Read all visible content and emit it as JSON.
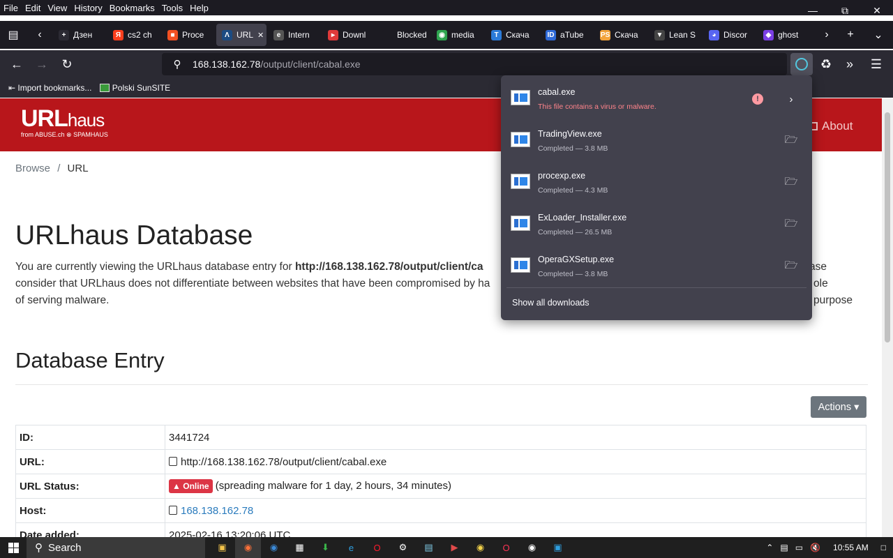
{
  "menu": [
    "File",
    "Edit",
    "View",
    "History",
    "Bookmarks",
    "Tools",
    "Help"
  ],
  "tabs": [
    {
      "label": "Дзен",
      "icon": "zen-icon",
      "color": "#2b2a33",
      "glyph": "+"
    },
    {
      "label": "cs2 ch",
      "icon": "yandex-icon",
      "color": "#fc3f1d",
      "glyph": "Я"
    },
    {
      "label": "Proce",
      "icon": "microsoft-icon",
      "color": "#f25022",
      "glyph": "■"
    },
    {
      "label": "URL",
      "icon": "abuse-icon",
      "color": "#1c4b82",
      "glyph": "Λ",
      "active": true
    },
    {
      "label": "Intern",
      "icon": "internet-icon",
      "color": "#555",
      "glyph": "e"
    },
    {
      "label": "Downl",
      "icon": "download-site-icon",
      "color": "#e03a3a",
      "glyph": "▸"
    },
    {
      "label": "Blocked",
      "icon": "blocked-icon",
      "color": "#1c1b22",
      "glyph": ""
    },
    {
      "label": "media",
      "icon": "media-icon",
      "color": "#2ea44f",
      "glyph": "◉"
    },
    {
      "label": "Скача",
      "icon": "telegram-t-icon",
      "color": "#2b7bd8",
      "glyph": "T"
    },
    {
      "label": "aTube",
      "icon": "atube-icon",
      "color": "#2f6ad8",
      "glyph": "ID"
    },
    {
      "label": "Скача",
      "icon": "ps-icon",
      "color": "#f2a33a",
      "glyph": "PS"
    },
    {
      "label": "Lean S",
      "icon": "lean-icon",
      "color": "#444",
      "glyph": "▼"
    },
    {
      "label": "Discor",
      "icon": "discord-icon",
      "color": "#5865f2",
      "glyph": "◕"
    },
    {
      "label": "ghost",
      "icon": "ghost-icon",
      "color": "#7b3fe4",
      "glyph": "◆"
    }
  ],
  "url": {
    "host": "168.138.162.78",
    "path": "/output/client/cabal.exe"
  },
  "bookmarks": [
    {
      "label": "Import bookmarks...",
      "icon": "import-icon"
    },
    {
      "label": "Polski SunSITE",
      "icon": "sunsite-icon"
    }
  ],
  "site": {
    "logo_main": "URL",
    "logo_sub": "haus",
    "logo_from": "from ABUSE.ch  ⊗ SPAMHAUS",
    "about": "About",
    "breadcrumb_browse": "Browse",
    "breadcrumb_sep": "/",
    "breadcrumb_current": "URL",
    "title": "URLhaus Database",
    "intro_pre": "You are currently viewing the URLhaus database entry for ",
    "intro_bold": "http://168.138.162.78/output/client/ca",
    "intro_line1_tail": "ase",
    "intro_line2": "consider that URLhaus does not differentiate between websites that have been compromised by ha",
    "intro_line2_tail": "ole purpose",
    "intro_line3": "of serving malware.",
    "section": "Database Entry",
    "actions": "Actions ▾",
    "rows": [
      {
        "key": "ID:",
        "value": "3441724"
      },
      {
        "key": "URL:",
        "value": "http://168.138.162.78/output/client/cabal.exe"
      },
      {
        "key": "URL Status:",
        "badge": "Online",
        "value": "(spreading malware for 1 day, 2 hours, 34 minutes)"
      },
      {
        "key": "Host:",
        "value": "168.138.162.78"
      },
      {
        "key": "Date added:",
        "value": "2025-02-16 13:20:06 UTC"
      }
    ]
  },
  "downloads": {
    "items": [
      {
        "name": "cabal.exe",
        "status": "This file contains a virus or malware.",
        "warning": true
      },
      {
        "name": "TradingView.exe",
        "status": "Completed — 3.8 MB"
      },
      {
        "name": "procexp.exe",
        "status": "Completed — 4.3 MB"
      },
      {
        "name": "ExLoader_Installer.exe",
        "status": "Completed — 26.5 MB"
      },
      {
        "name": "OperaGXSetup.exe",
        "status": "Completed — 3.8 MB"
      }
    ],
    "show_all": "Show all downloads"
  },
  "taskbar": {
    "search": "Search",
    "time": "10:55 AM"
  }
}
